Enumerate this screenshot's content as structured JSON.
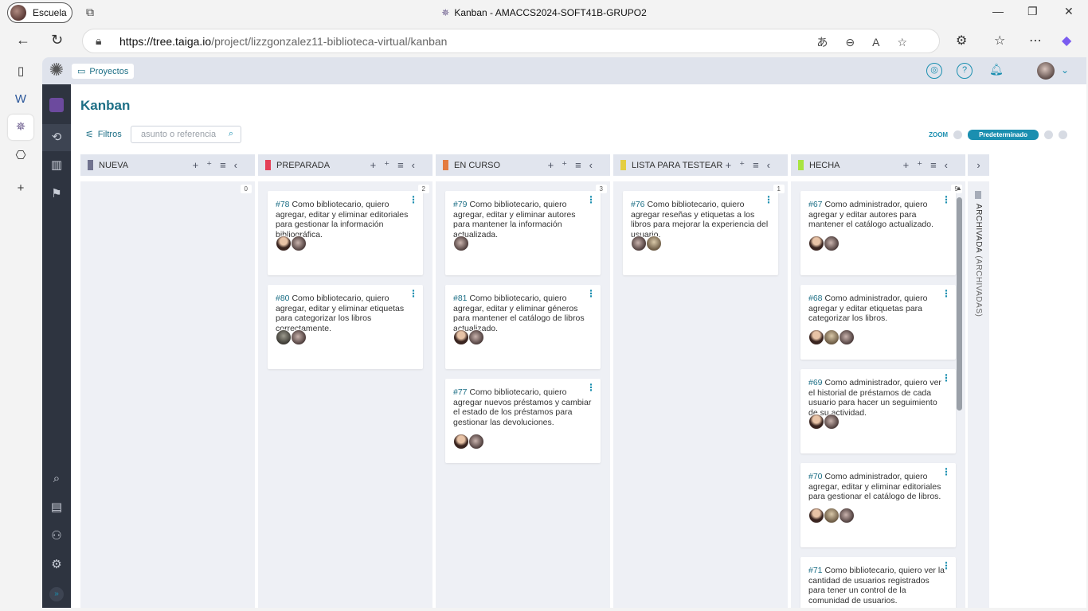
{
  "browser": {
    "profile_label": "Escuela",
    "window_title": "Kanban - AMACCS2024-SOFT41B-GRUPO2",
    "url_host": "https://tree.taiga.io",
    "url_path": "/project/lizzgonzalez11-biblioteca-virtual/kanban"
  },
  "app": {
    "breadcrumb": "Proyectos",
    "page_title": "Kanban",
    "filters_label": "Filtros",
    "search_placeholder": "asunto o referencia",
    "zoom_label": "ZOOM",
    "zoom_selected": "Predeterminado"
  },
  "columns": [
    {
      "name": "NUEVA",
      "color": "#70728f",
      "count": "0",
      "cards": []
    },
    {
      "name": "PREPARADA",
      "color": "#e44057",
      "count": "2",
      "cards": [
        {
          "ref": "#78",
          "text": " Como bibliotecario, quiero agregar, editar y eliminar editoriales para gestionar la información bibliográfica."
        },
        {
          "ref": "#80",
          "text": " Como bibliotecario, quiero agregar, editar y eliminar etiquetas para categorizar los libros correctamente."
        }
      ]
    },
    {
      "name": "EN CURSO",
      "color": "#e47c40",
      "count": "3",
      "cards": [
        {
          "ref": "#79",
          "text": " Como bibliotecario, quiero agregar, editar y eliminar autores para mantener la información actualizada."
        },
        {
          "ref": "#81",
          "text": " Como bibliotecario, quiero agregar, editar y eliminar géneros para mantener el catálogo de libros actualizado."
        },
        {
          "ref": "#77",
          "text": " Como bibliotecario, quiero agregar nuevos préstamos y cambiar el estado de los préstamos para gestionar las devoluciones."
        }
      ]
    },
    {
      "name": "LISTA PARA TESTEAR",
      "color": "#e4ce40",
      "count": "1",
      "cards": [
        {
          "ref": "#76",
          "text": " Como bibliotecario, quiero agregar reseñas y etiquetas a los libros para mejorar la experiencia del usuario."
        }
      ]
    },
    {
      "name": "HECHA",
      "color": "#a8e440",
      "count": "9",
      "cards": [
        {
          "ref": "#67",
          "text": " Como administrador, quiero agregar y editar autores para mantener el catálogo actualizado."
        },
        {
          "ref": "#68",
          "text": " Como administrador, quiero agregar y editar etiquetas para categorizar los libros."
        },
        {
          "ref": "#69",
          "text": " Como administrador, quiero ver el historial de préstamos de cada usuario para hacer un seguimiento de su actividad."
        },
        {
          "ref": "#70",
          "text": " Como administrador, quiero agregar, editar y eliminar editoriales para gestionar el catálogo de libros."
        },
        {
          "ref": "#71",
          "text": " Como bibliotecario, quiero ver la cantidad de usuarios registrados para tener un control de la comunidad de usuarios."
        }
      ]
    }
  ],
  "archived": {
    "label": "ARCHIVADA",
    "sub": "(ARCHIVADAS)"
  }
}
